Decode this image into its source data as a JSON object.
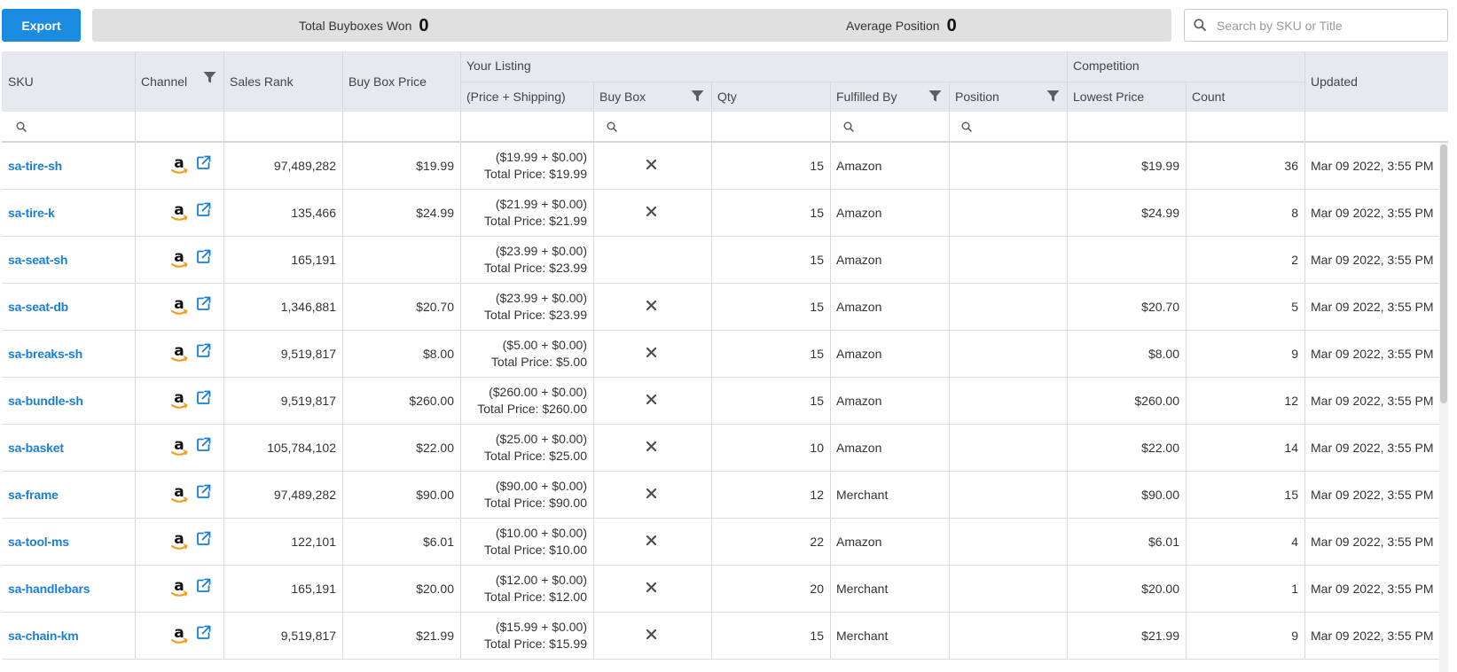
{
  "toolbar": {
    "export_label": "Export",
    "stats": [
      {
        "label": "Total Buyboxes Won",
        "value": "0"
      },
      {
        "label": "Average Position",
        "value": "0"
      }
    ],
    "search_placeholder": "Search by SKU or Title"
  },
  "table": {
    "group_headers": {
      "your_listing": "Your Listing",
      "competition": "Competition"
    },
    "columns": {
      "sku": "SKU",
      "channel": "Channel",
      "sales_rank": "Sales Rank",
      "buy_box_price": "Buy Box Price",
      "price_shipping": "(Price + Shipping)",
      "buy_box": "Buy Box",
      "qty": "Qty",
      "fulfilled_by": "Fulfilled By",
      "position": "Position",
      "lowest_price": "Lowest Price",
      "count": "Count",
      "updated": "Updated"
    },
    "rows": [
      {
        "sku": "sa-tire-sh",
        "sales_rank": "97,489,282",
        "buy_box_price": "$19.99",
        "price_line": "($19.99 + $0.00)",
        "total_line": "Total Price: $19.99",
        "buy_box_x": true,
        "qty": "15",
        "fulfilled_by": "Amazon",
        "position": "",
        "lowest_price": "$19.99",
        "count": "36",
        "updated": "Mar 09 2022, 3:55 PM"
      },
      {
        "sku": "sa-tire-k",
        "sales_rank": "135,466",
        "buy_box_price": "$24.99",
        "price_line": "($21.99 + $0.00)",
        "total_line": "Total Price: $21.99",
        "buy_box_x": true,
        "qty": "15",
        "fulfilled_by": "Amazon",
        "position": "",
        "lowest_price": "$24.99",
        "count": "8",
        "updated": "Mar 09 2022, 3:55 PM"
      },
      {
        "sku": "sa-seat-sh",
        "sales_rank": "165,191",
        "buy_box_price": "",
        "price_line": "($23.99 + $0.00)",
        "total_line": "Total Price: $23.99",
        "buy_box_x": false,
        "qty": "15",
        "fulfilled_by": "Amazon",
        "position": "",
        "lowest_price": "",
        "count": "2",
        "updated": "Mar 09 2022, 3:55 PM"
      },
      {
        "sku": "sa-seat-db",
        "sales_rank": "1,346,881",
        "buy_box_price": "$20.70",
        "price_line": "($23.99 + $0.00)",
        "total_line": "Total Price: $23.99",
        "buy_box_x": true,
        "qty": "15",
        "fulfilled_by": "Amazon",
        "position": "",
        "lowest_price": "$20.70",
        "count": "5",
        "updated": "Mar 09 2022, 3:55 PM"
      },
      {
        "sku": "sa-breaks-sh",
        "sales_rank": "9,519,817",
        "buy_box_price": "$8.00",
        "price_line": "($5.00 + $0.00)",
        "total_line": "Total Price: $5.00",
        "buy_box_x": true,
        "qty": "15",
        "fulfilled_by": "Amazon",
        "position": "",
        "lowest_price": "$8.00",
        "count": "9",
        "updated": "Mar 09 2022, 3:55 PM"
      },
      {
        "sku": "sa-bundle-sh",
        "sales_rank": "9,519,817",
        "buy_box_price": "$260.00",
        "price_line": "($260.00 + $0.00)",
        "total_line": "Total Price: $260.00",
        "buy_box_x": true,
        "qty": "15",
        "fulfilled_by": "Amazon",
        "position": "",
        "lowest_price": "$260.00",
        "count": "12",
        "updated": "Mar 09 2022, 3:55 PM"
      },
      {
        "sku": "sa-basket",
        "sales_rank": "105,784,102",
        "buy_box_price": "$22.00",
        "price_line": "($25.00 + $0.00)",
        "total_line": "Total Price: $25.00",
        "buy_box_x": true,
        "qty": "10",
        "fulfilled_by": "Amazon",
        "position": "",
        "lowest_price": "$22.00",
        "count": "14",
        "updated": "Mar 09 2022, 3:55 PM"
      },
      {
        "sku": "sa-frame",
        "sales_rank": "97,489,282",
        "buy_box_price": "$90.00",
        "price_line": "($90.00 + $0.00)",
        "total_line": "Total Price: $90.00",
        "buy_box_x": true,
        "qty": "12",
        "fulfilled_by": "Merchant",
        "position": "",
        "lowest_price": "$90.00",
        "count": "15",
        "updated": "Mar 09 2022, 3:55 PM"
      },
      {
        "sku": "sa-tool-ms",
        "sales_rank": "122,101",
        "buy_box_price": "$6.01",
        "price_line": "($10.00 + $0.00)",
        "total_line": "Total Price: $10.00",
        "buy_box_x": true,
        "qty": "22",
        "fulfilled_by": "Amazon",
        "position": "",
        "lowest_price": "$6.01",
        "count": "4",
        "updated": "Mar 09 2022, 3:55 PM"
      },
      {
        "sku": "sa-handlebars",
        "sales_rank": "165,191",
        "buy_box_price": "$20.00",
        "price_line": "($12.00 + $0.00)",
        "total_line": "Total Price: $12.00",
        "buy_box_x": true,
        "qty": "20",
        "fulfilled_by": "Merchant",
        "position": "",
        "lowest_price": "$20.00",
        "count": "1",
        "updated": "Mar 09 2022, 3:55 PM"
      },
      {
        "sku": "sa-chain-km",
        "sales_rank": "9,519,817",
        "buy_box_price": "$21.99",
        "price_line": "($15.99 + $0.00)",
        "total_line": "Total Price: $15.99",
        "buy_box_x": true,
        "qty": "15",
        "fulfilled_by": "Merchant",
        "position": "",
        "lowest_price": "$21.99",
        "count": "9",
        "updated": "Mar 09 2022, 3:55 PM"
      }
    ]
  },
  "icons": {
    "channel": "amazon-icon",
    "open_link": "external-link-icon",
    "filter": "filter-icon",
    "search": "search-icon",
    "buy_box_lost": "close-icon"
  },
  "colors": {
    "accent": "#1a8be0",
    "link": "#1a7fd4",
    "header_bg": "#e7e9ee",
    "stats_bg": "#e0e0e0"
  }
}
